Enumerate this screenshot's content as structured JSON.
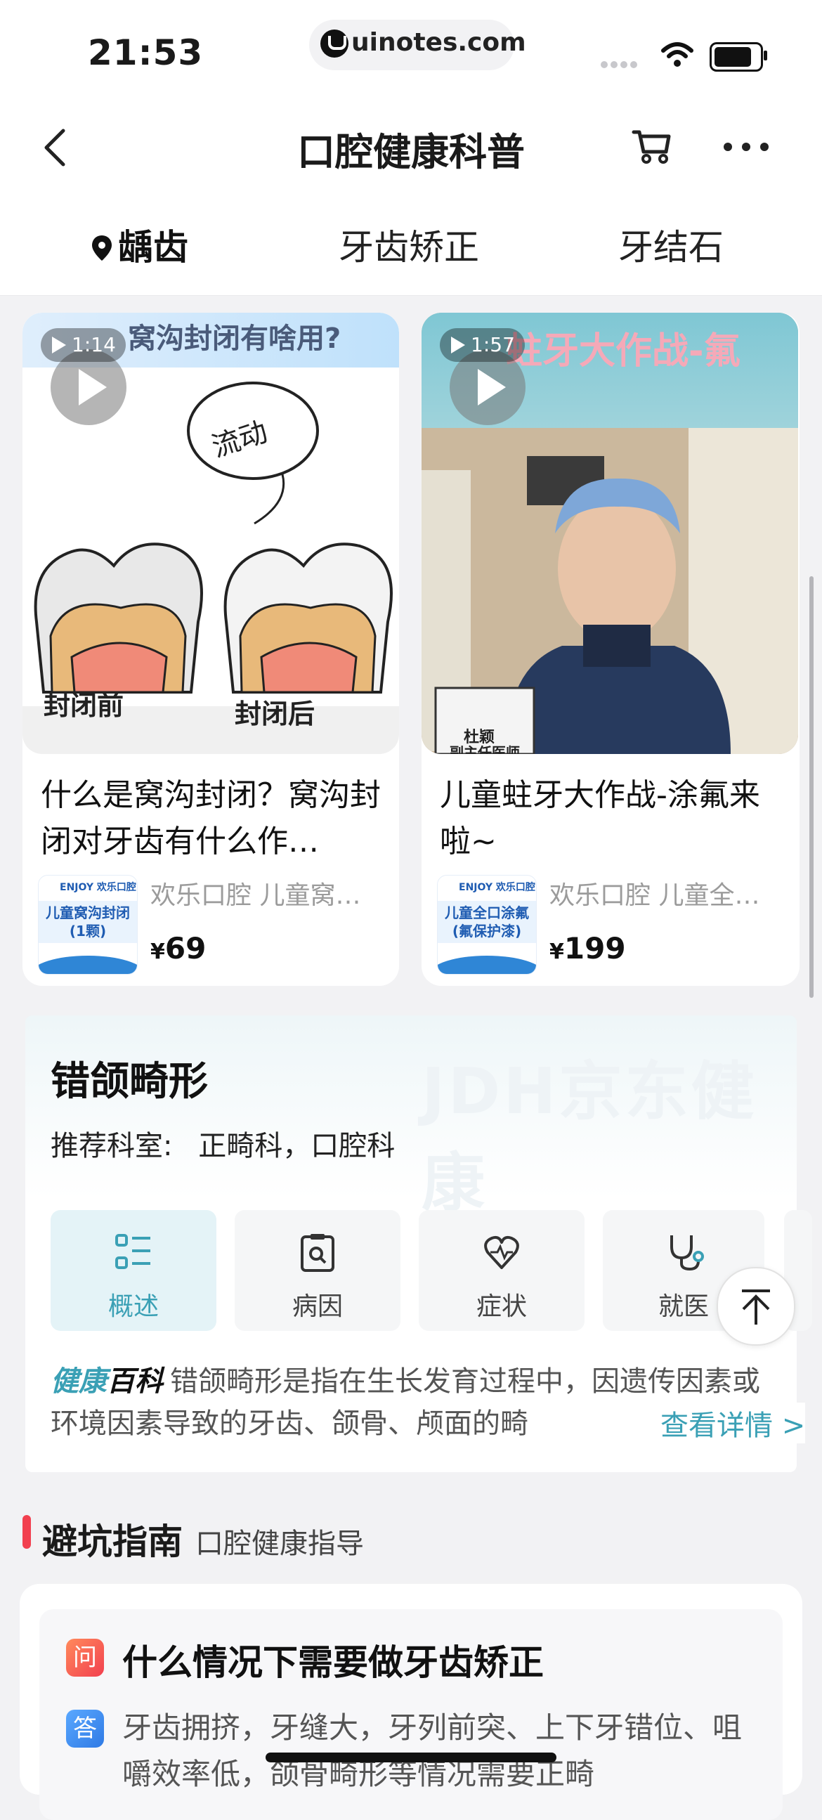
{
  "status": {
    "time": "21:53",
    "url": "uinotes.com"
  },
  "nav": {
    "title": "口腔健康科普"
  },
  "tabs": [
    {
      "label": "龋齿",
      "active": true
    },
    {
      "label": "牙齿矫正",
      "active": false
    },
    {
      "label": "牙结石",
      "active": false
    }
  ],
  "videos": [
    {
      "duration": "1:14",
      "banner": "窝沟封闭有啥用?",
      "bubble": "流动",
      "label_left": "封闭前",
      "label_right": "封闭后",
      "title": "什么是窝沟封闭？窝沟封闭对牙齿有什么作…",
      "shop": "欢乐口腔 儿童窝…",
      "product_logo": "ENJOY 欢乐口腔",
      "product_text": "儿童窝沟封闭(1颗)",
      "price_symbol": "¥",
      "price": "69"
    },
    {
      "duration": "1:57",
      "banner": "蛀牙大作战-氟",
      "name_plate_1": "杜颖",
      "name_plate_2": "副主任医师",
      "title": "儿童蛀牙大作战-涂氟来啦~",
      "shop": "欢乐口腔 儿童全…",
      "product_logo": "ENJOY 欢乐口腔",
      "product_text": "儿童全口涂氟(氟保护漆)",
      "price_symbol": "¥",
      "price": "199"
    }
  ],
  "disease": {
    "watermark": "JDH京东健康",
    "title": "错颌畸形",
    "dept_label": "推荐科室:",
    "dept_value": "正畸科，口腔科",
    "buttons": [
      {
        "label": "概述",
        "icon": "list-icon"
      },
      {
        "label": "病因",
        "icon": "clipboard-search-icon"
      },
      {
        "label": "症状",
        "icon": "heart-pulse-icon"
      },
      {
        "label": "就医",
        "icon": "stethoscope-icon"
      }
    ],
    "brand_a": "健康",
    "brand_b": "百科",
    "desc": "错颌畸形是指在生长发育过程中，因遗传因素或环境因素导致的牙齿、颌骨、颅面的畸",
    "more": "查看详情 >"
  },
  "guide": {
    "title": "避坑指南",
    "subtitle": "口腔健康指导",
    "q_icon": "问",
    "question": "什么情况下需要做牙齿矫正",
    "a_icon": "答",
    "answer": "牙齿拥挤，牙缝大，牙列前突、上下牙错位、咀嚼效率低，颌骨畸形等情况需要正畸"
  },
  "colors": {
    "accent": "#3aa0b5",
    "guide_bar": "#f2404f",
    "background": "#f2f2f4"
  }
}
